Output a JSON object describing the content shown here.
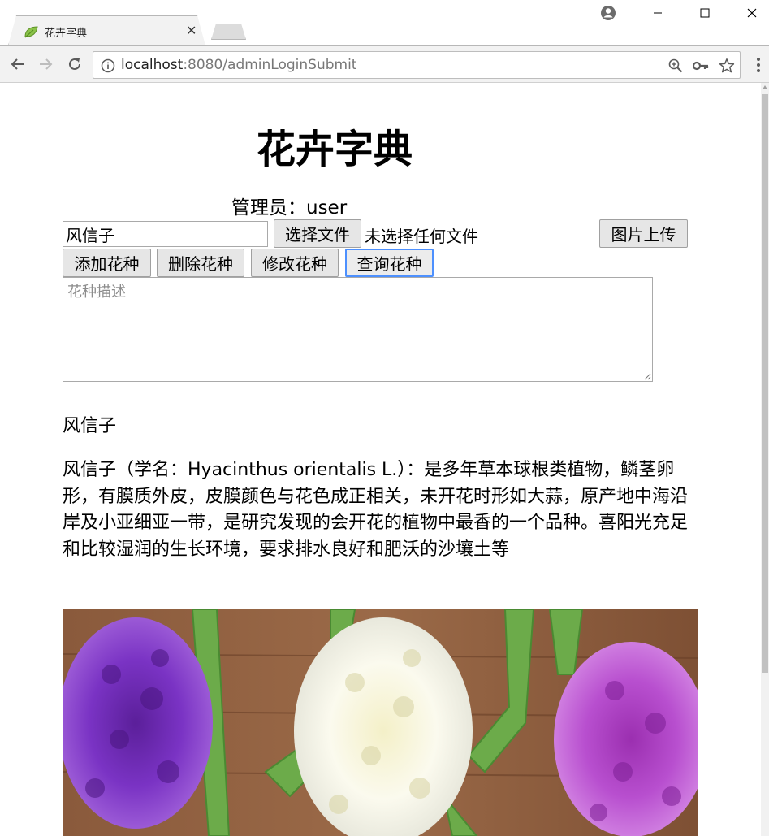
{
  "browser": {
    "tab_title": "花卉字典",
    "url_host": "localhost",
    "url_rest": ":8080/adminLoginSubmit"
  },
  "page": {
    "title": "花卉字典",
    "admin_label": "管理员：",
    "admin_name": "user",
    "name_input_value": "风信子",
    "choose_file_label": "选择文件",
    "no_file_text": "未选择任何文件",
    "upload_label": "图片上传",
    "add_label": "添加花种",
    "delete_label": "删除花种",
    "modify_label": "修改花种",
    "query_label": "查询花种",
    "desc_placeholder": "花种描述"
  },
  "result": {
    "name": "风信子",
    "description": "风信子（学名：Hyacinthus orientalis L.）：是多年草本球根类植物，鳞茎卵形，有膜质外皮，皮膜颜色与花色成正相关，未开花时形如大蒜，原产地中海沿岸及小亚细亚一带，是研究发现的会开花的植物中最香的一个品种。喜阳光充足和比较湿润的生长环境，要求排水良好和肥沃的沙壤土等"
  },
  "icons": {
    "favicon": "leaf-icon",
    "close_tab": "close-icon",
    "back": "arrow-left-icon",
    "forward": "arrow-right-icon",
    "reload": "reload-icon",
    "info": "info-icon",
    "zoom": "zoom-icon",
    "key": "key-icon",
    "star": "star-icon",
    "menu": "menu-dots-icon",
    "account": "account-icon"
  },
  "colors": {
    "focus_ring": "#4d90fe",
    "chrome_bg": "#f2f2f2",
    "button_bg": "#e6e6e6"
  }
}
